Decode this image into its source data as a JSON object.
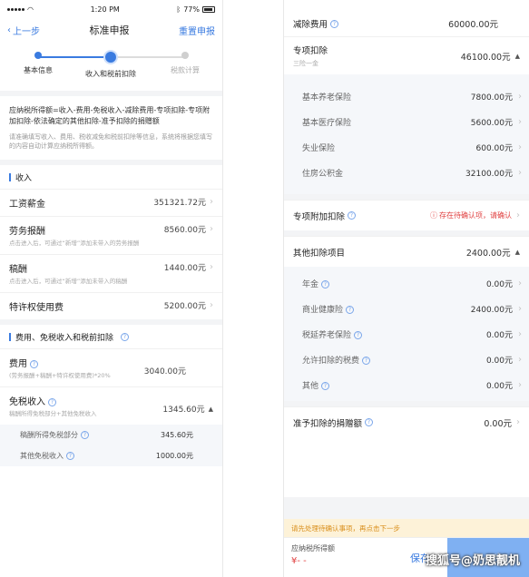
{
  "left": {
    "status": {
      "time": "1:20 PM",
      "battery": "77%"
    },
    "nav": {
      "back": "上一步",
      "title": "标准申报",
      "reset": "重置申报"
    },
    "steps": [
      "基本信息",
      "收入和税前扣除",
      "税款计算"
    ],
    "formula": "应纳税所得额=收入-费用-免税收入-减除费用-专项扣除-专项附加扣除-依法确定的其他扣除-准予扣除的捐赠额",
    "formula_note": "请准确填写收入、费用、税收减免和税前扣除等信息，系统将根据您填写的内容自动计算应纳税所得额。",
    "income": {
      "title": "收入",
      "rows": [
        {
          "label": "工资薪金",
          "value": "351321.72元",
          "sub": ""
        },
        {
          "label": "劳务报酬",
          "value": "8560.00元",
          "sub": "点击进入后，可通过“新增”添加未带入的劳务报酬"
        },
        {
          "label": "稿酬",
          "value": "1440.00元",
          "sub": "点击进入后，可通过“新增”添加未带入的稿酬"
        },
        {
          "label": "特许权使用费",
          "value": "5200.00元",
          "sub": ""
        }
      ]
    },
    "deduct": {
      "title": "费用、免税收入和税前扣除",
      "fee": {
        "label": "费用",
        "value": "3040.00元",
        "sub": "(劳务报酬+稿酬+特许权使用费)*20%"
      },
      "exempt": {
        "label": "免税收入",
        "value": "1345.60元",
        "sub": "稿酬所得免税部分+其他免税收入"
      },
      "exempt_items": [
        {
          "label": "稿酬所得免税部分",
          "value": "345.60元"
        },
        {
          "label": "其他免税收入",
          "value": "1000.00元"
        }
      ]
    }
  },
  "right": {
    "deduction_fee": {
      "label": "减除费用",
      "value": "60000.00元"
    },
    "special": {
      "label": "专项扣除",
      "sub": "三险一金",
      "value": "46100.00元"
    },
    "special_items": [
      {
        "label": "基本养老保险",
        "value": "7800.00元"
      },
      {
        "label": "基本医疗保险",
        "value": "5600.00元"
      },
      {
        "label": "失业保险",
        "value": "600.00元"
      },
      {
        "label": "住房公积金",
        "value": "32100.00元"
      }
    ],
    "additional": {
      "label": "专项附加扣除",
      "warn": "存在待确认项，请确认"
    },
    "other": {
      "label": "其他扣除项目",
      "value": "2400.00元"
    },
    "other_items": [
      {
        "label": "年金",
        "value": "0.00元"
      },
      {
        "label": "商业健康险",
        "value": "2400.00元"
      },
      {
        "label": "税延养老保险",
        "value": "0.00元"
      },
      {
        "label": "允许扣除的税费",
        "value": "0.00元"
      },
      {
        "label": "其他",
        "value": "0.00元"
      }
    ],
    "donation": {
      "label": "准予扣除的捐赠额",
      "value": "0.00元"
    },
    "banner": "请先处理待确认事项，再点击下一步",
    "bottom": {
      "label": "应纳税所得额",
      "amount": "¥- -",
      "save": "保存",
      "next": "下一步"
    },
    "watermark": "搜狐号@奶思靓机"
  }
}
